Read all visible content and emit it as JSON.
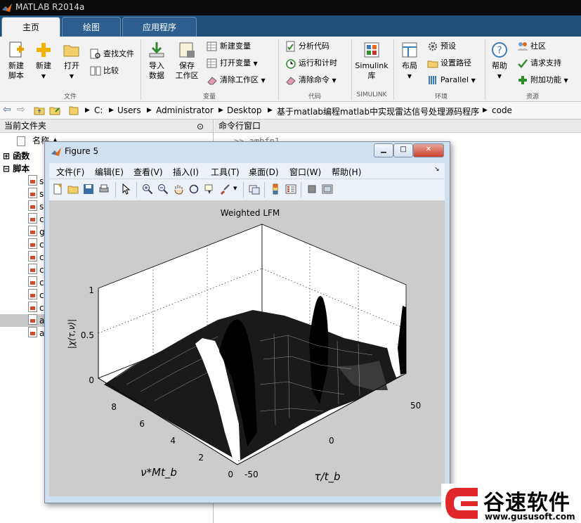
{
  "app": {
    "title": "MATLAB R2014a"
  },
  "tabs": [
    "主页",
    "绘图",
    "应用程序"
  ],
  "ribbon": {
    "file": {
      "new_script": "新建\n脚本",
      "new": "新建",
      "open": "打开",
      "find_files": "查找文件",
      "compare": "比较",
      "group": "文件"
    },
    "variable": {
      "import": "导入\n数据",
      "save_ws": "保存\n工作区",
      "new_var": "新建变量",
      "open_var": "打开变量",
      "clear_ws": "清除工作区",
      "group": "变量"
    },
    "code": {
      "analyze": "分析代码",
      "run_time": "运行和计时",
      "clear_cmd": "清除命令",
      "group": "代码"
    },
    "simulink": {
      "lib": "Simulink\n库",
      "group": "SIMULINK"
    },
    "env": {
      "layout": "布局",
      "prefs": "预设",
      "set_path": "设置路径",
      "parallel": "Parallel",
      "group": "环境"
    },
    "resources": {
      "help": "帮助",
      "community": "社区",
      "support": "请求支持",
      "addons": "附加功能",
      "group": "资源"
    }
  },
  "address": {
    "parts": [
      "C:",
      "Users",
      "Administrator",
      "Desktop",
      "基于matlab编程matlab中实现雷达信号处理源码程序",
      "code"
    ]
  },
  "left_panel": {
    "title": "当前文件夹",
    "col_name": "名称 ▲",
    "groups": [
      "函数",
      "脚本"
    ],
    "files": [
      "s",
      "s",
      "s",
      "c",
      "g",
      "c",
      "c",
      "c",
      "c",
      "c",
      "c",
      "a",
      "a"
    ]
  },
  "right_panel": {
    "title": "命令行窗口",
    "prompt": ">> ambfn1"
  },
  "figure": {
    "title": "Figure 5",
    "menus": [
      "文件(F)",
      "编辑(E)",
      "查看(V)",
      "插入(I)",
      "工具(T)",
      "桌面(D)",
      "窗口(W)",
      "帮助(H)"
    ],
    "plot_title": "Weighted LFM",
    "zlabel": "|χ(τ,ν)|",
    "xlabel": "τ/t_b",
    "ylabel": "ν*Mt_b",
    "zticks": [
      "1",
      "0.5",
      "0"
    ],
    "yticks": [
      "8",
      "6",
      "4",
      "2",
      "0"
    ],
    "xticks": [
      "-50",
      "0",
      "50"
    ]
  },
  "watermark": {
    "brand": "谷速软件",
    "url": "www.gususoft.com"
  },
  "colors": {
    "titlebar": "#0b0b0b",
    "tabstrip": "#1f4e78",
    "ribbon": "#f2f2f2",
    "figure_frame": "#cfe0f1",
    "accent_red": "#e0282b"
  }
}
